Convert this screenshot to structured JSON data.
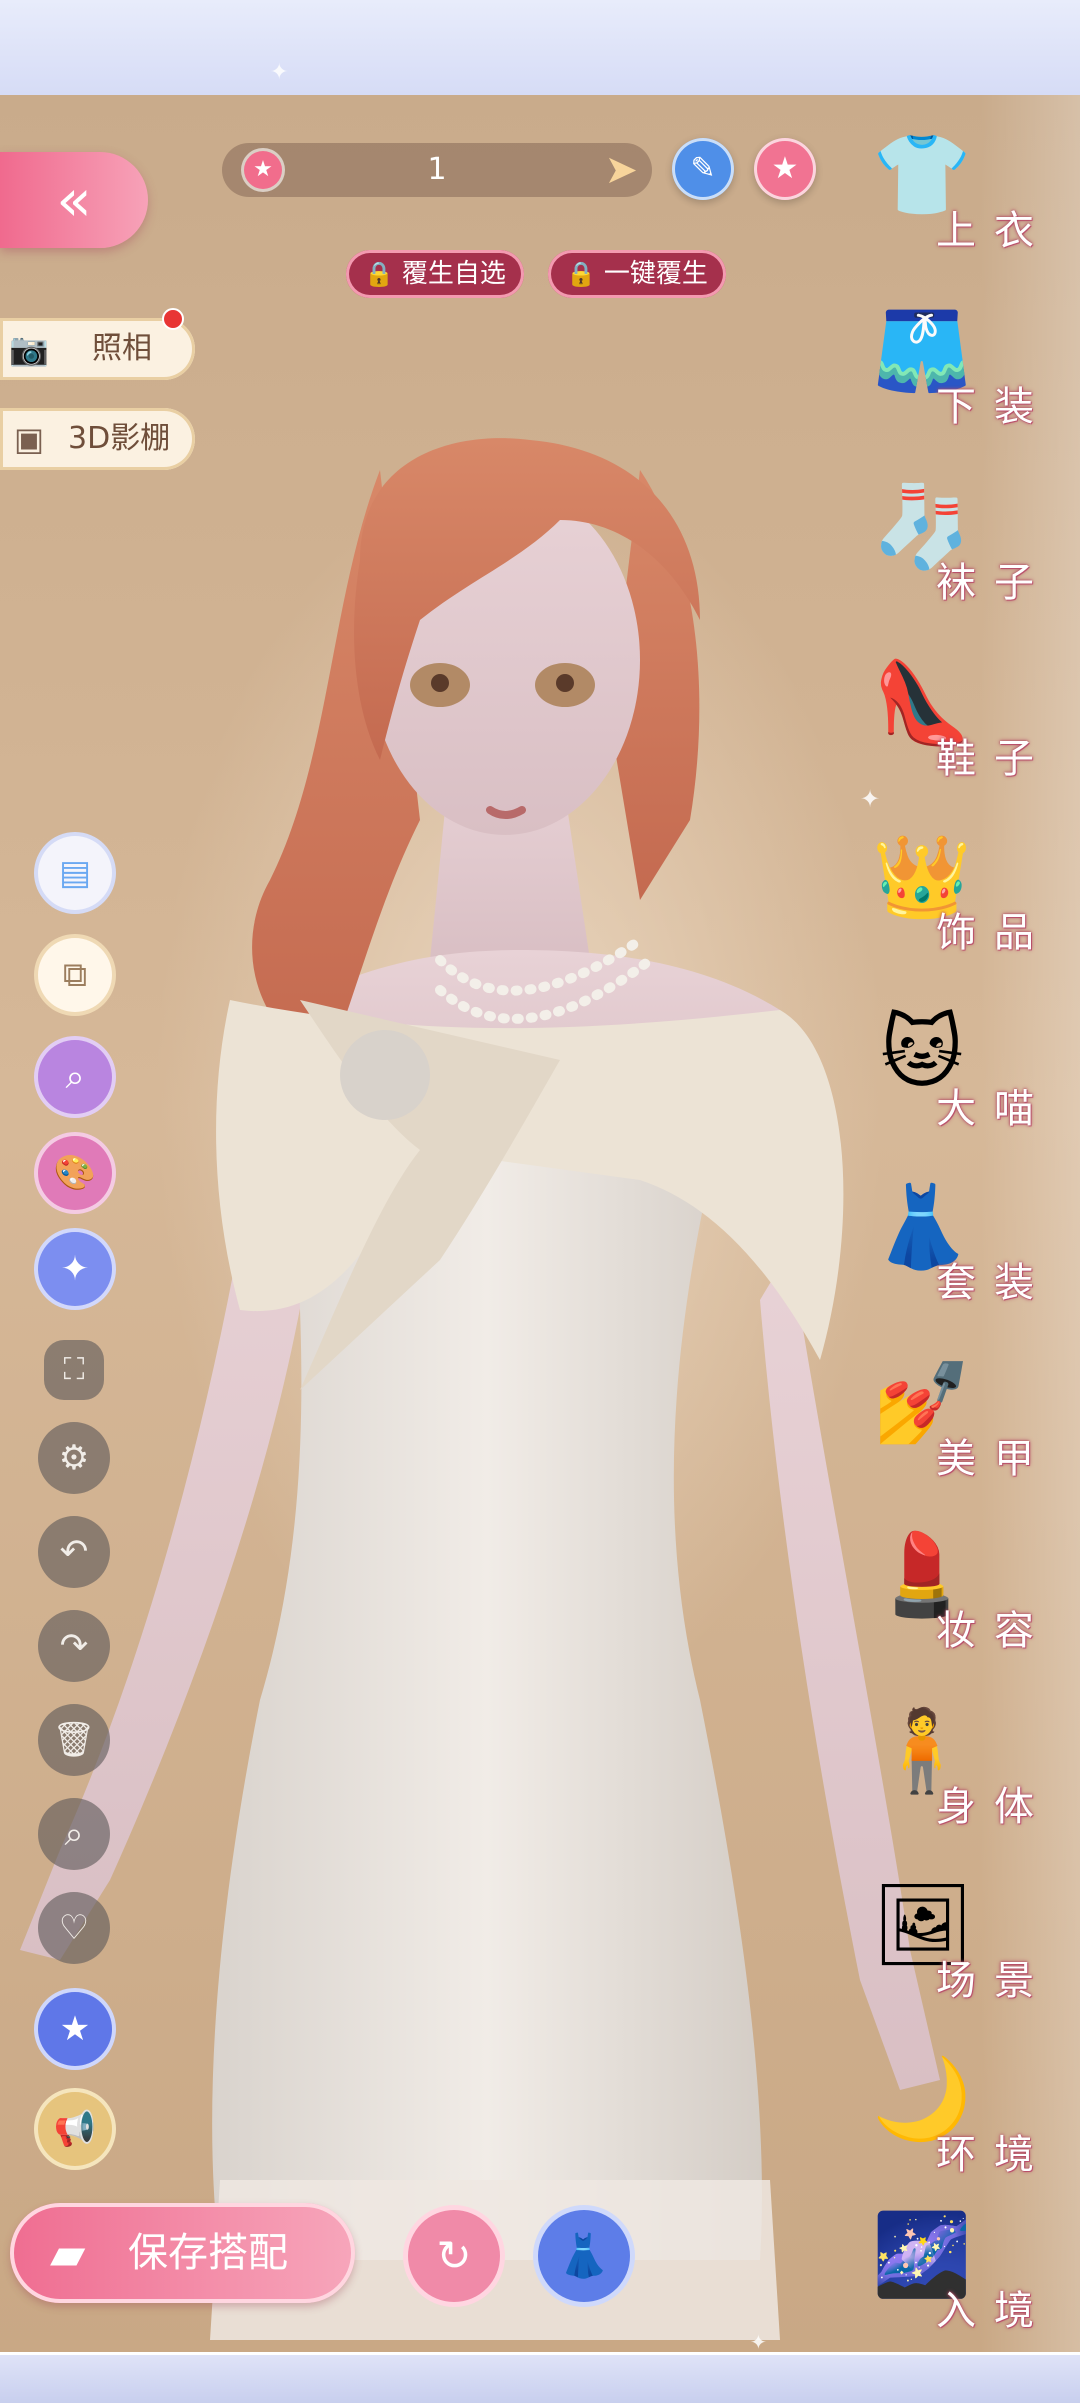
{
  "top_bar": {
    "counter_value": "1",
    "star_icon": "star-icon",
    "arrow_icon": "arrow-right-icon",
    "pencil_icon": "pencil-icon",
    "favorite_icon": "star-icon"
  },
  "lock_buttons": [
    {
      "label": "覆生自选"
    },
    {
      "label": "一键覆生"
    }
  ],
  "left_pills": {
    "photo_label": "照相",
    "studio_label": "3D影棚"
  },
  "right_categories": [
    {
      "label": "上衣",
      "icon": "shirt-icon",
      "glyph": "👕"
    },
    {
      "label": "下装",
      "icon": "shorts-icon",
      "glyph": "🩳"
    },
    {
      "label": "袜子",
      "icon": "sock-icon",
      "glyph": "🧦"
    },
    {
      "label": "鞋子",
      "icon": "shoe-icon",
      "glyph": "👠"
    },
    {
      "label": "饰品",
      "icon": "tiara-icon",
      "glyph": "👑"
    },
    {
      "label": "大喵",
      "icon": "cat-icon",
      "glyph": "🐱"
    },
    {
      "label": "套装",
      "icon": "outfit-set-icon",
      "glyph": "👗"
    },
    {
      "label": "美甲",
      "icon": "nail-polish-icon",
      "glyph": "💅"
    },
    {
      "label": "妆容",
      "icon": "makeup-icon",
      "glyph": "💄"
    },
    {
      "label": "身体",
      "icon": "body-icon",
      "glyph": "🧍"
    },
    {
      "label": "场景",
      "icon": "scene-icon",
      "glyph": "🖼"
    },
    {
      "label": "环境",
      "icon": "moon-icon",
      "glyph": "🌙"
    },
    {
      "label": "入境",
      "icon": "portal-icon",
      "glyph": "🌌"
    }
  ],
  "bottom": {
    "save_label": "保存搭配"
  },
  "colors": {
    "accent_pink": "#f06a8e",
    "accent_blue": "#5d7de8",
    "background": "#c9ab8b"
  }
}
